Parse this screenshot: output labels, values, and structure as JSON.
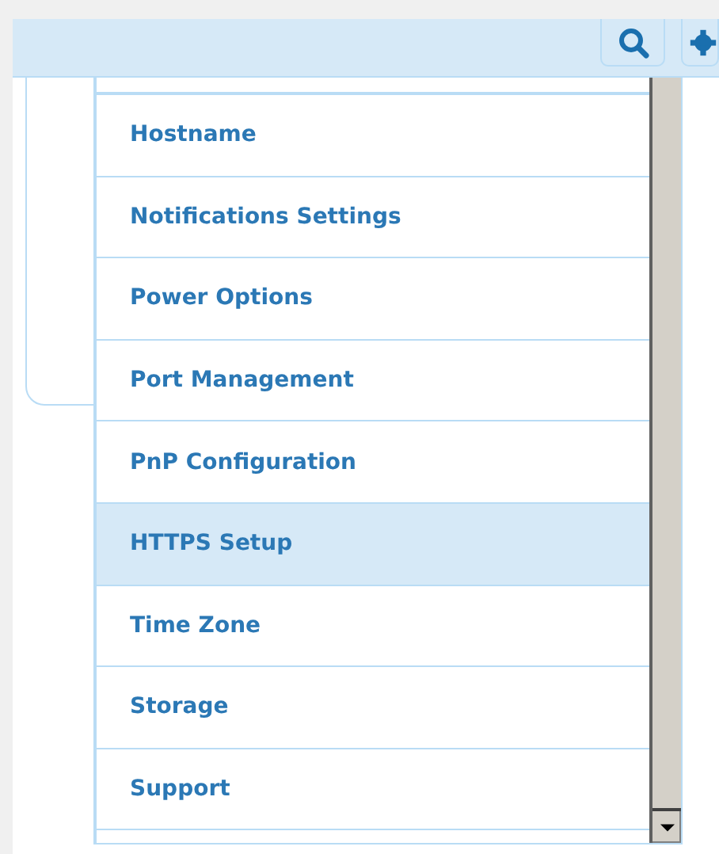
{
  "toolbar": {
    "buttons": [
      {
        "kind": "search"
      },
      {
        "kind": "gear"
      }
    ]
  },
  "menu": {
    "items": [
      {
        "label": "Hostname",
        "selected": false
      },
      {
        "label": "Notifications Settings",
        "selected": false
      },
      {
        "label": "Power Options",
        "selected": false
      },
      {
        "label": "Port Management",
        "selected": false
      },
      {
        "label": "PnP Configuration",
        "selected": false
      },
      {
        "label": "HTTPS Setup",
        "selected": true
      },
      {
        "label": "Time Zone",
        "selected": false
      },
      {
        "label": "Storage",
        "selected": false
      },
      {
        "label": "Support",
        "selected": false
      }
    ]
  }
}
